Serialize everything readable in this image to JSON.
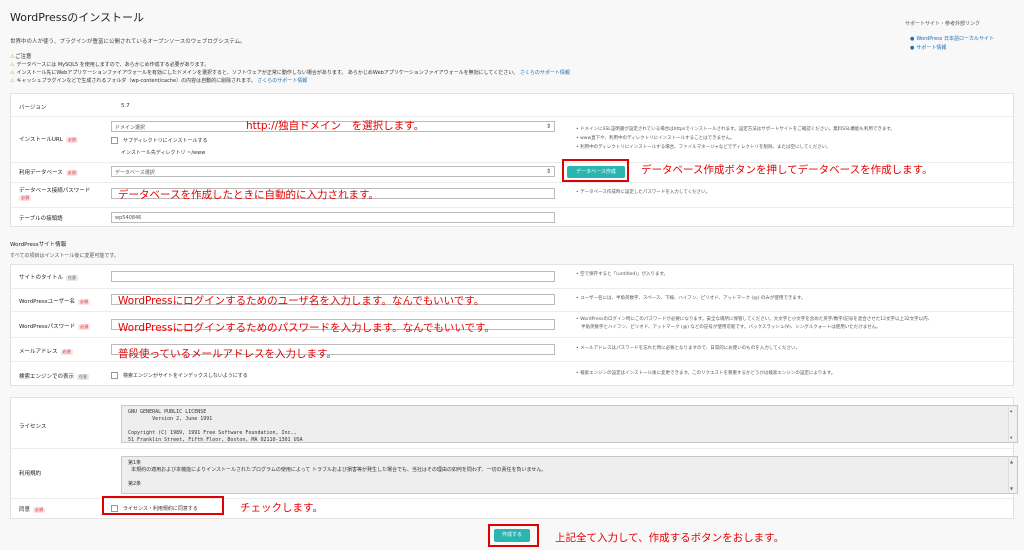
{
  "header": {
    "title": "WordPressのインストール",
    "description": "世界中の人が使う、プラグインが豊富に公開されているオープンソースのウェブログシステム。"
  },
  "notice": {
    "title": "ご注意",
    "items": [
      "データベースには MySQL5 を使用しますので、あらかじめ作成する必要があります。",
      "インストール先にWebアプリケーションファイアウォールを有効にしたドメインを選択すると、ソフトウェアが正常に動作しない場合があります。 あらかじめWebアプリケーションファイアウォールを無効にしてください。",
      "キャッシュプラグインなどで生成されるフォルダ（wp-content/cache）の内容は自動的に削除されます。"
    ],
    "link1": "さくらのサポート情報",
    "link2": "さくらのサポート情報"
  },
  "sidebar": {
    "title": "サポートサイト・参考外部リンク",
    "links": [
      "WordPress 日本語ローカルサイト",
      "サポート情報"
    ]
  },
  "form": {
    "version_label": "バージョン",
    "version_value": "5.7",
    "install_url_label": "インストールURL",
    "required_tag": "必須",
    "optional_tag": "任意",
    "domain_placeholder": "ドメイン選択",
    "subdir_label": "サブディレクトリにインストールする",
    "install_dir_label": "インストール先ディレクトリ",
    "install_dir_value": "~/www",
    "db_label": "利用データベース",
    "db_placeholder": "データベース選択",
    "create_db_button": "データベース作成",
    "db_password_label": "データベース接続パスワード",
    "table_prefix_label": "テーブルの接頭語",
    "table_prefix_value": "wp540846",
    "help_url_1": "ドメインにSSL証明書が設定されている場合はhttpsでインストールされます。設定方法はサポートサイトをご確認ください。無料SSL機能も利用できます。",
    "help_url_2": "www直下や、利用中のディレクトリにインストールすることはできません。",
    "help_url_3": "利用中のディレクトリにインストールする場合、ファイルマネージャなどでディレクトリを削除、または空にしてください。",
    "help_db_password": "データベース作成時に設定したパスワードを入力してください。"
  },
  "site_info": {
    "heading": "WordPressサイト情報",
    "subheading": "すべての項目はインストール後に変更可能です。",
    "site_title_label": "サイトのタイトル",
    "username_label": "WordPressユーザー名",
    "password_label": "WordPressパスワード",
    "email_label": "メールアドレス",
    "search_engine_label": "検索エンジンでの表示",
    "search_engine_check": "検索エンジンがサイトをインデックスしないようにする",
    "help_title": "空で保存すると「(untitled)」が入ります。",
    "help_username": "ユーザー名には、半角英数字、スペース、下線、ハイフン、ピリオド、アットマーク (@) のみが使用できます。",
    "help_password_1": "WordPressのログイン時にこのパスワードが必要になります。安全な場所に保管してください。大文字と小文字を含めた英字/数字/記号を混合させた12文字以上32文字以内、",
    "help_password_2": "半角英数字とハイフン、ピリオド、アットマーク (@) などの記号が使用可能です。バックスラッシュ(¥)、シングルクォートは使用いただけません。",
    "help_email": "メールアドレスはパスワードを忘れた時に必要となりますので、日常的にお使いのものを入力してください。",
    "help_search": "検索エンジンの設定はインストール後に変更できます。このリクエストを尊重するかどうかは検索エンジンの設定によります。"
  },
  "license": {
    "label": "ライセンス",
    "text": "GNU GENERAL PUBLIC LICENSE\n        Version 2, June 1991\n\nCopyright (C) 1989, 1991 Free Software Foundation, Inc.,\n51 Franklin Street, Fifth Floor, Boston, MA 02110-1301 USA",
    "terms_label": "利用規約",
    "terms_text": "第1条\n  本規約の適用および本機能によりインストールされたプログラムの使用によって トラブルおよび損害等が発生した場合でも、当社はその理由の如何を問わず、一切の責任を負いません。\n\n第2条",
    "agree_label": "同意",
    "agree_check": "ライセンス・利用規約に同意する",
    "submit_button": "作成する"
  },
  "annotations": {
    "url": "http://独自ドメイン　を選択します。",
    "create_db": "データベース作成ボタンを押してデータベースを作成します。",
    "db_password": "データベースを作成したときに自動的に入力されます。",
    "username": "WordPressにログインするためのユーザ名を入力します。なんでもいいです。",
    "password": "WordPressにログインするためのパスワードを入力します。なんでもいいです。",
    "email": "普段使っているメールアドレスを入力します。",
    "agree": "チェックします。",
    "submit": "上記全て入力して、作成するボタンをおします。"
  },
  "colors": {
    "accent": "#2ab5b0",
    "annotation": "#e60000",
    "required": "#dd2233"
  }
}
